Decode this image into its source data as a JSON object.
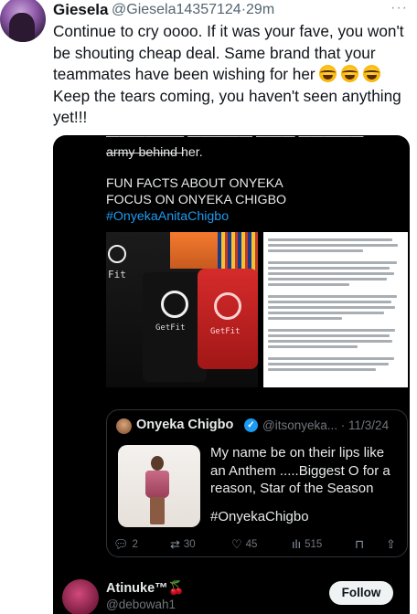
{
  "tweet": {
    "author_name": "Giesela",
    "author_handle": "@Giesela14357124",
    "separator": "·",
    "time": "29m",
    "more_icon": "more-horizontal-icon",
    "text_part1": "Continue to cry oooo. If it was your fave, you won't be shouting cheap deal. Same brand that your teammates have been wishing for her ",
    "text_part2": " Keep the tears coming, you haven't seen anything yet!!!",
    "emoji_icon": "face-with-tears-of-joy-icon"
  },
  "embedded": {
    "line_cut": "—————— ————— ——— ————— ——————",
    "line_army": "army behind her.",
    "fun_fact_line1": "FUN FACTS ABOUT ONYEKA",
    "fun_fact_line2": "FOCUS ON ONYEKA CHIGBO",
    "hashtag": "#OnyekaAnitaChigbo",
    "brand_label": "GetFit",
    "brand_label_short": "Fit",
    "quote": {
      "name": "Onyeka Chigbo",
      "handle": "@itsonyeka...",
      "separator": "·",
      "date": "11/3/24",
      "verified_icon": "verified-badge-icon",
      "text": "My name be on their lips like an Anthem .....Biggest O for a reason, Star of the Season",
      "hashtag": "#OnyekaChigbo"
    },
    "stats": {
      "replies": "2",
      "retweets": "30",
      "likes": "45",
      "views": "515"
    },
    "bottom_user": {
      "name": "Atinuke™🍒",
      "handle": "@debowah1",
      "follow_label": "Follow"
    }
  },
  "colors": {
    "link_blue": "#1d9bf0",
    "dark_bg": "#000000",
    "muted_gray": "#536471"
  }
}
